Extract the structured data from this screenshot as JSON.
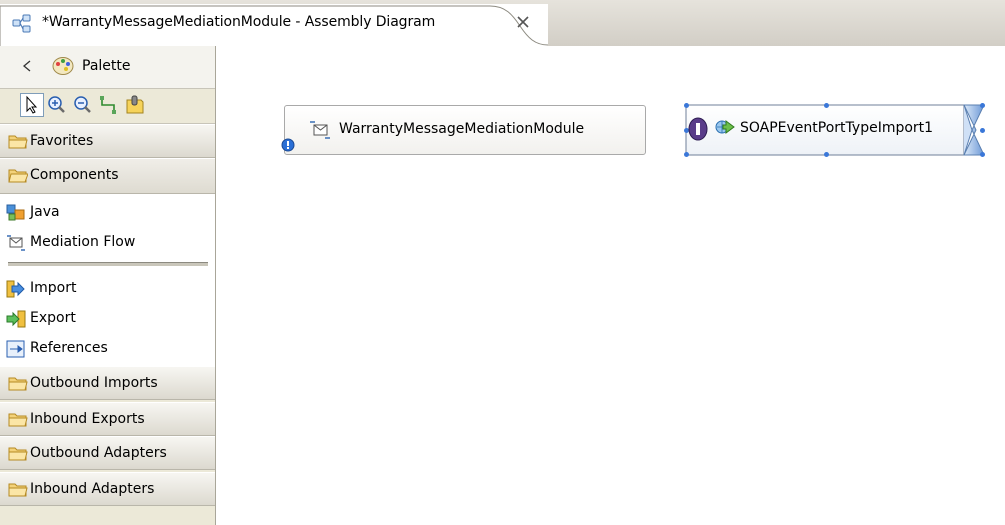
{
  "editor": {
    "tab_title": "*WarrantyMessageMediationModule - Assembly Diagram",
    "tab_icon": "assembly-diagram-icon",
    "close_icon": "close-icon"
  },
  "palette": {
    "title": "Palette",
    "tools": [
      "select-arrow-icon",
      "zoom-in-icon",
      "zoom-out-icon",
      "wire-tool-icon",
      "note-tool-icon"
    ],
    "drawers_top": [
      {
        "label": "Favorites",
        "open": false
      },
      {
        "label": "Components",
        "open": true
      }
    ],
    "entries": [
      {
        "label": "Java",
        "icon": "java-component-icon"
      },
      {
        "label": "Mediation Flow",
        "icon": "mediation-flow-icon"
      },
      {
        "label": "Import",
        "icon": "import-icon"
      },
      {
        "label": "Export",
        "icon": "export-icon"
      },
      {
        "label": "References",
        "icon": "references-icon"
      }
    ],
    "drawers_bottom": [
      {
        "label": "Outbound Imports"
      },
      {
        "label": "Inbound Exports"
      },
      {
        "label": "Outbound Adapters"
      },
      {
        "label": "Inbound Adapters"
      }
    ]
  },
  "canvas": {
    "module_node": {
      "label": "WarrantyMessageMediationModule",
      "has_error": true
    },
    "import_node": {
      "label": "SOAPEventPortTypeImport1",
      "selected": true
    }
  },
  "colors": {
    "selection_handle": "#3a77d8",
    "import_fill": "#dce9f8",
    "import_arrow": "#6b98d6"
  }
}
